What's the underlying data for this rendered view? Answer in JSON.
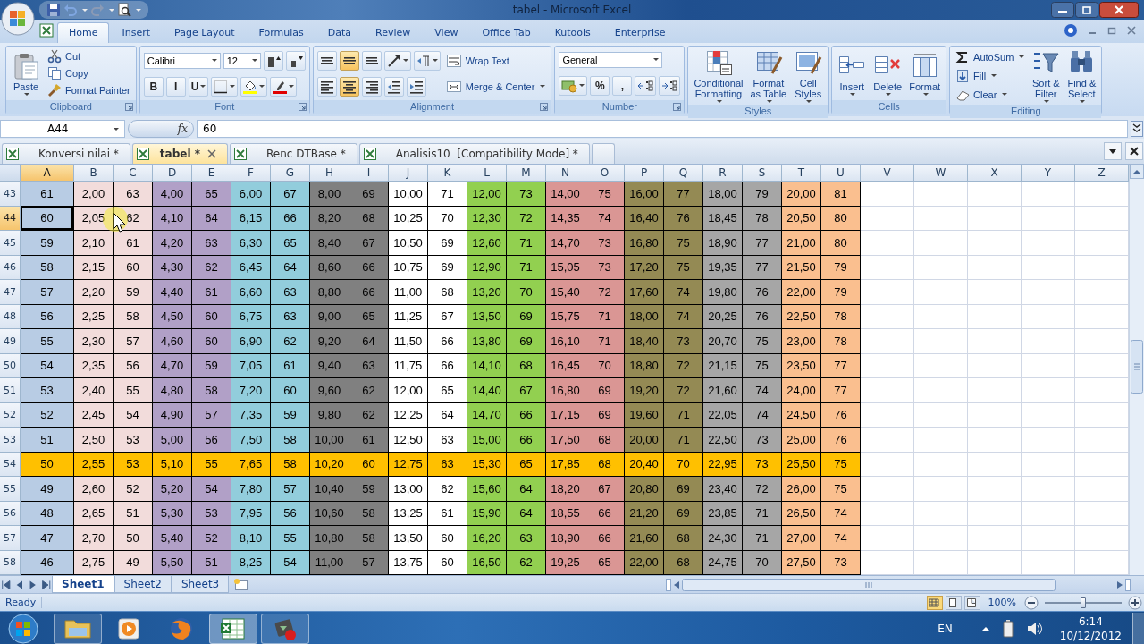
{
  "window": {
    "title": "tabel - Microsoft Excel"
  },
  "menu_tabs": [
    {
      "label": "Home",
      "selected": true
    },
    {
      "label": "Insert",
      "selected": false
    },
    {
      "label": "Page Layout",
      "selected": false
    },
    {
      "label": "Formulas",
      "selected": false
    },
    {
      "label": "Data",
      "selected": false
    },
    {
      "label": "Review",
      "selected": false
    },
    {
      "label": "View",
      "selected": false
    },
    {
      "label": "Office Tab",
      "selected": false
    },
    {
      "label": "Kutools",
      "selected": false
    },
    {
      "label": "Enterprise",
      "selected": false
    }
  ],
  "ribbon": [
    {
      "label": "Clipboard",
      "launcher": true,
      "columns": [
        [
          {
            "kind": "large",
            "label": "Paste",
            "dropdown": true
          }
        ],
        [
          {
            "kind": "small",
            "label": "Cut"
          },
          {
            "kind": "small",
            "label": "Copy"
          },
          {
            "kind": "small",
            "label": "Format Painter"
          }
        ]
      ]
    },
    {
      "label": "Font",
      "launcher": true,
      "columns": [
        [
          {
            "kind": "row",
            "items": [
              {
                "kind": "field",
                "value": "Calibri",
                "dropdown": true
              },
              {
                "kind": "field",
                "value": "12",
                "dropdown": true
              },
              {
                "kind": "icon"
              },
              {
                "kind": "icon"
              }
            ]
          },
          {
            "kind": "row",
            "items": [
              {
                "kind": "text",
                "label": "B"
              },
              {
                "kind": "text",
                "label": "I"
              },
              {
                "kind": "text",
                "label": "U",
                "dropdown": true
              },
              {
                "kind": "icon",
                "dropdown": true
              },
              {
                "kind": "icon",
                "dropdown": true
              },
              {
                "kind": "icon",
                "dropdown": true
              }
            ]
          }
        ]
      ]
    },
    {
      "label": "Alignment",
      "launcher": true,
      "columns": [
        [
          {
            "kind": "row",
            "items": [
              {
                "kind": "icon",
                "selected": false
              },
              {
                "kind": "icon",
                "selected": true
              },
              {
                "kind": "icon",
                "selected": false
              },
              {
                "kind": "icon",
                "dropdown": true
              },
              {
                "kind": "icon",
                "dropdown": true
              }
            ]
          },
          {
            "kind": "row",
            "items": [
              {
                "kind": "icon",
                "selected": false
              },
              {
                "kind": "icon",
                "selected": true
              },
              {
                "kind": "icon",
                "selected": false
              },
              {
                "kind": "icon"
              },
              {
                "kind": "icon"
              }
            ]
          }
        ],
        [
          {
            "kind": "small",
            "label": "Wrap Text"
          },
          {
            "kind": "small",
            "label": "Merge & Center",
            "dropdown": true
          }
        ]
      ]
    },
    {
      "label": "Number",
      "launcher": true,
      "columns": [
        [
          {
            "kind": "row",
            "items": [
              {
                "kind": "field",
                "value": "General",
                "dropdown": true
              }
            ]
          },
          {
            "kind": "row",
            "items": [
              {
                "kind": "icon",
                "dropdown": true
              },
              {
                "kind": "text",
                "label": "%"
              },
              {
                "kind": "text",
                "label": ","
              },
              {
                "kind": "icon"
              },
              {
                "kind": "icon"
              }
            ]
          }
        ]
      ]
    },
    {
      "label": "Styles",
      "launcher": false,
      "columns": [
        [
          {
            "kind": "large",
            "label": "Conditional\nFormatting",
            "dropdown": true
          }
        ],
        [
          {
            "kind": "large",
            "label": "Format\nas Table",
            "dropdown": true
          }
        ],
        [
          {
            "kind": "large",
            "label": "Cell\nStyles",
            "dropdown": true
          }
        ]
      ]
    },
    {
      "label": "Cells",
      "launcher": false,
      "columns": [
        [
          {
            "kind": "large",
            "label": "Insert",
            "dropdown": true
          }
        ],
        [
          {
            "kind": "large",
            "label": "Delete",
            "dropdown": true
          }
        ],
        [
          {
            "kind": "large",
            "label": "Format",
            "dropdown": true
          }
        ]
      ]
    },
    {
      "label": "Editing",
      "launcher": false,
      "columns": [
        [
          {
            "kind": "small",
            "label": "AutoSum",
            "dropdown": true
          },
          {
            "kind": "small",
            "label": "Fill",
            "dropdown": true
          },
          {
            "kind": "small",
            "label": "Clear",
            "dropdown": true
          }
        ],
        [
          {
            "kind": "large",
            "label": "Sort &\nFilter",
            "dropdown": true
          }
        ],
        [
          {
            "kind": "large",
            "label": "Find &\nSelect",
            "dropdown": true
          }
        ]
      ]
    }
  ],
  "formula_bar": {
    "name_box": "A44",
    "function_label": "fx",
    "value": "60"
  },
  "document_tabs": [
    {
      "label": "Konversi nilai *",
      "selected": false
    },
    {
      "label": "tabel *",
      "selected": true,
      "closable": true
    },
    {
      "label": "Renc DTBase *",
      "selected": false
    },
    {
      "label": "Analisis10  [Compatibility Mode] *",
      "selected": false
    }
  ],
  "columns": [
    {
      "letter": "A",
      "color": "#b8cce4",
      "selected": true
    },
    {
      "letter": "B",
      "color": "#f2dcdb",
      "selected": false
    },
    {
      "letter": "C",
      "color": "#f2dcdb",
      "selected": false
    },
    {
      "letter": "D",
      "color": "#b1a0c7",
      "selected": false
    },
    {
      "letter": "E",
      "color": "#b1a0c7",
      "selected": false
    },
    {
      "letter": "F",
      "color": "#92cddc",
      "selected": false
    },
    {
      "letter": "G",
      "color": "#92cddc",
      "selected": false
    },
    {
      "letter": "H",
      "color": "#808080",
      "selected": false
    },
    {
      "letter": "I",
      "color": "#808080",
      "selected": false
    },
    {
      "letter": "J",
      "color": "#ffffff",
      "selected": false
    },
    {
      "letter": "K",
      "color": "#ffffff",
      "selected": false
    },
    {
      "letter": "L",
      "color": "#92d050",
      "selected": false
    },
    {
      "letter": "M",
      "color": "#92d050",
      "selected": false
    },
    {
      "letter": "N",
      "color": "#da9694",
      "selected": false
    },
    {
      "letter": "O",
      "color": "#da9694",
      "selected": false
    },
    {
      "letter": "P",
      "color": "#948a54",
      "selected": false
    },
    {
      "letter": "Q",
      "color": "#948a54",
      "selected": false
    },
    {
      "letter": "R",
      "color": "#a6a6a6",
      "selected": false
    },
    {
      "letter": "S",
      "color": "#a6a6a6",
      "selected": false
    },
    {
      "letter": "T",
      "color": "#fabf8f",
      "selected": false
    },
    {
      "letter": "U",
      "color": "#fabf8f",
      "selected": false
    },
    {
      "letter": "V",
      "selected": false
    },
    {
      "letter": "W",
      "selected": false
    },
    {
      "letter": "X",
      "selected": false
    },
    {
      "letter": "Y",
      "selected": false
    },
    {
      "letter": "Z",
      "selected": false
    }
  ],
  "rows": [
    {
      "number": "43",
      "selected": false,
      "highlighted": false,
      "cells": [
        "61",
        "2,00",
        "63",
        "4,00",
        "65",
        "6,00",
        "67",
        "8,00",
        "69",
        "10,00",
        "71",
        "12,00",
        "73",
        "14,00",
        "75",
        "16,00",
        "77",
        "18,00",
        "79",
        "20,00",
        "81"
      ]
    },
    {
      "number": "44",
      "selected": true,
      "highlighted": false,
      "cells": [
        "60",
        "2,05",
        "62",
        "4,10",
        "64",
        "6,15",
        "66",
        "8,20",
        "68",
        "10,25",
        "70",
        "12,30",
        "72",
        "14,35",
        "74",
        "16,40",
        "76",
        "18,45",
        "78",
        "20,50",
        "80"
      ]
    },
    {
      "number": "45",
      "selected": false,
      "highlighted": false,
      "cells": [
        "59",
        "2,10",
        "61",
        "4,20",
        "63",
        "6,30",
        "65",
        "8,40",
        "67",
        "10,50",
        "69",
        "12,60",
        "71",
        "14,70",
        "73",
        "16,80",
        "75",
        "18,90",
        "77",
        "21,00",
        "80"
      ]
    },
    {
      "number": "46",
      "selected": false,
      "highlighted": false,
      "cells": [
        "58",
        "2,15",
        "60",
        "4,30",
        "62",
        "6,45",
        "64",
        "8,60",
        "66",
        "10,75",
        "69",
        "12,90",
        "71",
        "15,05",
        "73",
        "17,20",
        "75",
        "19,35",
        "77",
        "21,50",
        "79"
      ]
    },
    {
      "number": "47",
      "selected": false,
      "highlighted": false,
      "cells": [
        "57",
        "2,20",
        "59",
        "4,40",
        "61",
        "6,60",
        "63",
        "8,80",
        "66",
        "11,00",
        "68",
        "13,20",
        "70",
        "15,40",
        "72",
        "17,60",
        "74",
        "19,80",
        "76",
        "22,00",
        "79"
      ]
    },
    {
      "number": "48",
      "selected": false,
      "highlighted": false,
      "cells": [
        "56",
        "2,25",
        "58",
        "4,50",
        "60",
        "6,75",
        "63",
        "9,00",
        "65",
        "11,25",
        "67",
        "13,50",
        "69",
        "15,75",
        "71",
        "18,00",
        "74",
        "20,25",
        "76",
        "22,50",
        "78"
      ]
    },
    {
      "number": "49",
      "selected": false,
      "highlighted": false,
      "cells": [
        "55",
        "2,30",
        "57",
        "4,60",
        "60",
        "6,90",
        "62",
        "9,20",
        "64",
        "11,50",
        "66",
        "13,80",
        "69",
        "16,10",
        "71",
        "18,40",
        "73",
        "20,70",
        "75",
        "23,00",
        "78"
      ]
    },
    {
      "number": "50",
      "selected": false,
      "highlighted": false,
      "cells": [
        "54",
        "2,35",
        "56",
        "4,70",
        "59",
        "7,05",
        "61",
        "9,40",
        "63",
        "11,75",
        "66",
        "14,10",
        "68",
        "16,45",
        "70",
        "18,80",
        "72",
        "21,15",
        "75",
        "23,50",
        "77"
      ]
    },
    {
      "number": "51",
      "selected": false,
      "highlighted": false,
      "cells": [
        "53",
        "2,40",
        "55",
        "4,80",
        "58",
        "7,20",
        "60",
        "9,60",
        "62",
        "12,00",
        "65",
        "14,40",
        "67",
        "16,80",
        "69",
        "19,20",
        "72",
        "21,60",
        "74",
        "24,00",
        "77"
      ]
    },
    {
      "number": "52",
      "selected": false,
      "highlighted": false,
      "cells": [
        "52",
        "2,45",
        "54",
        "4,90",
        "57",
        "7,35",
        "59",
        "9,80",
        "62",
        "12,25",
        "64",
        "14,70",
        "66",
        "17,15",
        "69",
        "19,60",
        "71",
        "22,05",
        "74",
        "24,50",
        "76"
      ]
    },
    {
      "number": "53",
      "selected": false,
      "highlighted": false,
      "cells": [
        "51",
        "2,50",
        "53",
        "5,00",
        "56",
        "7,50",
        "58",
        "10,00",
        "61",
        "12,50",
        "63",
        "15,00",
        "66",
        "17,50",
        "68",
        "20,00",
        "71",
        "22,50",
        "73",
        "25,00",
        "76"
      ]
    },
    {
      "number": "54",
      "selected": false,
      "highlighted": true,
      "cells": [
        "50",
        "2,55",
        "53",
        "5,10",
        "55",
        "7,65",
        "58",
        "10,20",
        "60",
        "12,75",
        "63",
        "15,30",
        "65",
        "17,85",
        "68",
        "20,40",
        "70",
        "22,95",
        "73",
        "25,50",
        "75"
      ]
    },
    {
      "number": "55",
      "selected": false,
      "highlighted": false,
      "cells": [
        "49",
        "2,60",
        "52",
        "5,20",
        "54",
        "7,80",
        "57",
        "10,40",
        "59",
        "13,00",
        "62",
        "15,60",
        "64",
        "18,20",
        "67",
        "20,80",
        "69",
        "23,40",
        "72",
        "26,00",
        "75"
      ]
    },
    {
      "number": "56",
      "selected": false,
      "highlighted": false,
      "cells": [
        "48",
        "2,65",
        "51",
        "5,30",
        "53",
        "7,95",
        "56",
        "10,60",
        "58",
        "13,25",
        "61",
        "15,90",
        "64",
        "18,55",
        "66",
        "21,20",
        "69",
        "23,85",
        "71",
        "26,50",
        "74"
      ]
    },
    {
      "number": "57",
      "selected": false,
      "highlighted": false,
      "cells": [
        "47",
        "2,70",
        "50",
        "5,40",
        "52",
        "8,10",
        "55",
        "10,80",
        "58",
        "13,50",
        "60",
        "16,20",
        "63",
        "18,90",
        "66",
        "21,60",
        "68",
        "24,30",
        "71",
        "27,00",
        "74"
      ]
    },
    {
      "number": "58",
      "selected": false,
      "highlighted": false,
      "cells": [
        "46",
        "2,75",
        "49",
        "5,50",
        "51",
        "8,25",
        "54",
        "11,00",
        "57",
        "13,75",
        "60",
        "16,50",
        "62",
        "19,25",
        "65",
        "22,00",
        "68",
        "24,75",
        "70",
        "27,50",
        "73"
      ]
    }
  ],
  "sheet_tabs": [
    {
      "label": "Sheet1",
      "selected": true
    },
    {
      "label": "Sheet2",
      "selected": false
    },
    {
      "label": "Sheet3",
      "selected": false
    }
  ],
  "status_bar": {
    "status": "Ready",
    "view_buttons": [
      {
        "selected": true
      },
      {
        "selected": false
      },
      {
        "selected": false
      }
    ],
    "zoom": "100%",
    "zoom_slider": {
      "level": 0.5
    }
  },
  "taskbar": {
    "apps": [
      {
        "running": true,
        "selected": false
      },
      {
        "running": false,
        "selected": false
      },
      {
        "running": false,
        "selected": false
      },
      {
        "running": true,
        "selected": true
      },
      {
        "running": true,
        "selected": false
      }
    ],
    "language": "EN",
    "time": "6:14",
    "date": "10/12/2012"
  }
}
